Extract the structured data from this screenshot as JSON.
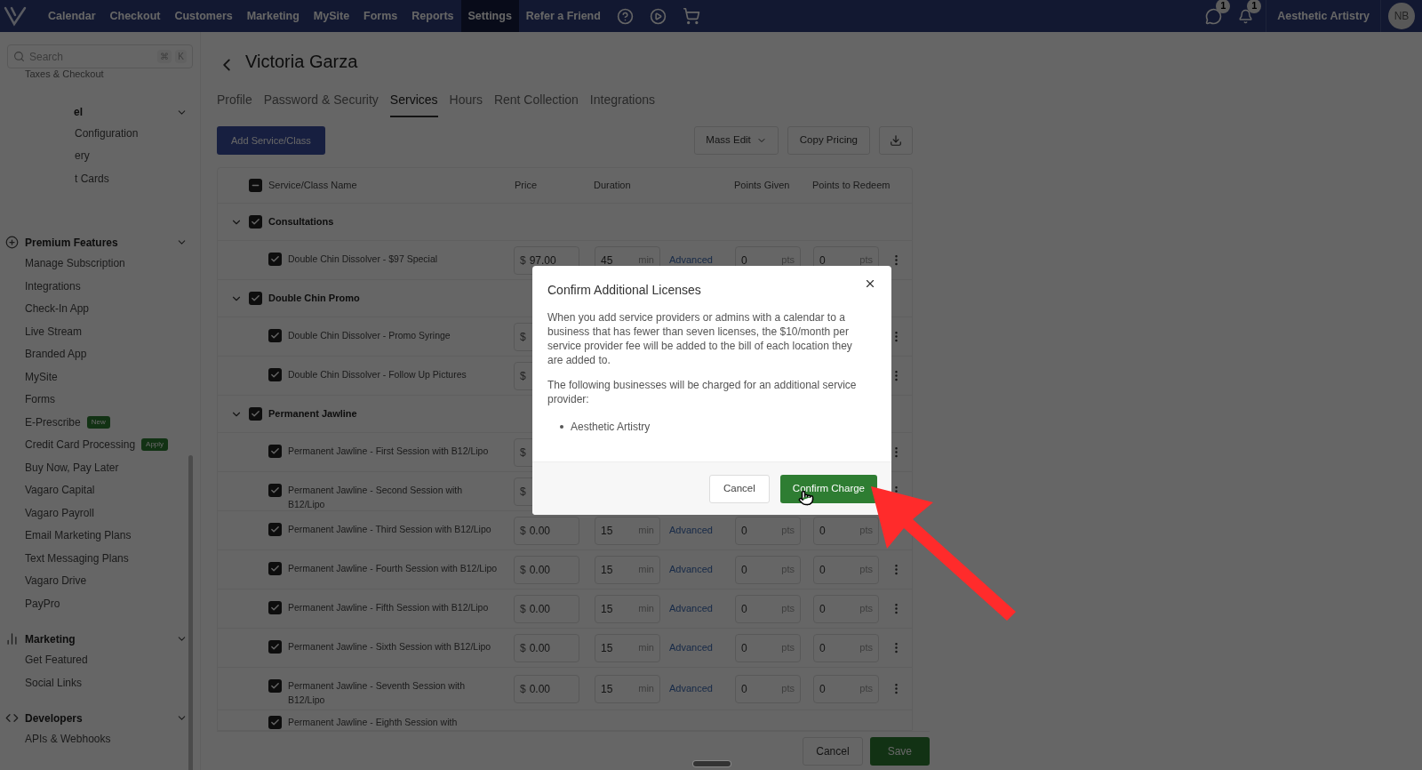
{
  "top_nav": {
    "items": [
      {
        "label": "Calendar",
        "selected": false
      },
      {
        "label": "Checkout",
        "selected": false
      },
      {
        "label": "Customers",
        "selected": false
      },
      {
        "label": "Marketing",
        "selected": false
      },
      {
        "label": "MySite",
        "selected": false
      },
      {
        "label": "Forms",
        "selected": false
      },
      {
        "label": "Reports",
        "selected": false
      },
      {
        "label": "Settings",
        "selected": true
      },
      {
        "label": "Refer a Friend",
        "selected": false
      }
    ],
    "message_badge": "1",
    "notification_badge": "1",
    "business": "Aesthetic Artistry",
    "avatar": "NB"
  },
  "sidebar": {
    "search": {
      "placeholder": "Search",
      "keys": [
        "⌘",
        "K"
      ]
    },
    "leading_items": [
      "Taxes & Checkout"
    ],
    "sections": [
      {
        "title": "el",
        "kind": "plain",
        "expanded": true,
        "items": [
          {
            "label": "Configuration"
          },
          {
            "label": "ery"
          },
          {
            "label": "t Cards"
          }
        ]
      },
      {
        "title": "Premium Features",
        "kind": "premium",
        "expanded": true,
        "items": [
          {
            "label": "Manage Subscription"
          },
          {
            "label": "Integrations"
          },
          {
            "label": "Check-In App"
          },
          {
            "label": "Live Stream"
          },
          {
            "label": "Branded App"
          },
          {
            "label": "MySite"
          },
          {
            "label": "Forms"
          },
          {
            "label": "E-Prescribe",
            "badge": "New"
          },
          {
            "label": "Credit Card Processing",
            "badge": "Apply"
          },
          {
            "label": "Buy Now, Pay Later"
          },
          {
            "label": "Vagaro Capital"
          },
          {
            "label": "Vagaro Payroll"
          },
          {
            "label": "Email Marketing Plans"
          },
          {
            "label": "Text Messaging Plans"
          },
          {
            "label": "Vagaro Drive"
          },
          {
            "label": "PayPro"
          }
        ]
      },
      {
        "title": "Marketing",
        "kind": "marketing",
        "expanded": true,
        "items": [
          {
            "label": "Get Featured"
          },
          {
            "label": "Social Links"
          }
        ]
      },
      {
        "title": "Developers",
        "kind": "developer",
        "expanded": true,
        "items": [
          {
            "label": "APIs & Webhooks"
          }
        ]
      }
    ]
  },
  "page": {
    "title": "Victoria Garza",
    "tabs": [
      {
        "label": "Profile",
        "selected": false
      },
      {
        "label": "Password & Security",
        "selected": false
      },
      {
        "label": "Services",
        "selected": true
      },
      {
        "label": "Hours",
        "selected": false
      },
      {
        "label": "Rent Collection",
        "selected": false
      },
      {
        "label": "Integrations",
        "selected": false
      }
    ],
    "add_button": "Add Service/Class",
    "mass_edit": "Mass Edit",
    "copy_pricing": "Copy Pricing",
    "table": {
      "all_indeterminate": true,
      "columns": [
        "Service/Class Name",
        "Price",
        "Duration",
        "Points Given",
        "Points to Redeem"
      ],
      "groups": [
        {
          "name": "Consultations",
          "checked": true,
          "expanded": true,
          "rows": [
            {
              "name": "Double Chin Dissolver - $97 Special",
              "checked": true,
              "currency": "$",
              "price": "97.00",
              "duration": "45",
              "duration_unit": "min",
              "advanced": "Advanced",
              "points_given": "0",
              "points_given_unit": "pts",
              "points_redeem": "0",
              "points_redeem_unit": "pts"
            }
          ]
        },
        {
          "name": "Double Chin Promo",
          "checked": true,
          "expanded": true,
          "rows": [
            {
              "name": "Double Chin Dissolver - Promo Syringe",
              "checked": true,
              "currency": "$"
            },
            {
              "name": "Double Chin Dissolver - Follow Up Pictures",
              "checked": true,
              "currency": "$"
            }
          ]
        },
        {
          "name": "Permanent Jawline",
          "checked": true,
          "expanded": true,
          "rows": [
            {
              "name": "Permanent Jawline - First Session with B12/Lipo",
              "checked": true,
              "currency": "$"
            },
            {
              "name": "Permanent Jawline - Second Session with B12/Lipo",
              "checked": true,
              "currency": "$"
            },
            {
              "name": "Permanent Jawline - Third Session with B12/Lipo",
              "checked": true,
              "currency": "$",
              "price": "0.00",
              "duration": "15",
              "duration_unit": "min",
              "advanced": "Advanced",
              "points_given": "0",
              "points_given_unit": "pts",
              "points_redeem": "0",
              "points_redeem_unit": "pts"
            },
            {
              "name": "Permanent Jawline - Fourth Session with B12/Lipo",
              "checked": true,
              "currency": "$",
              "price": "0.00",
              "duration": "15",
              "duration_unit": "min",
              "advanced": "Advanced",
              "points_given": "0",
              "points_given_unit": "pts",
              "points_redeem": "0",
              "points_redeem_unit": "pts"
            },
            {
              "name": "Permanent Jawline - Fifth Session with B12/Lipo",
              "checked": true,
              "currency": "$",
              "price": "0.00",
              "duration": "15",
              "duration_unit": "min",
              "advanced": "Advanced",
              "points_given": "0",
              "points_given_unit": "pts",
              "points_redeem": "0",
              "points_redeem_unit": "pts"
            },
            {
              "name": "Permanent Jawline - Sixth Session with B12/Lipo",
              "checked": true,
              "currency": "$",
              "price": "0.00",
              "duration": "15",
              "duration_unit": "min",
              "advanced": "Advanced",
              "points_given": "0",
              "points_given_unit": "pts",
              "points_redeem": "0",
              "points_redeem_unit": "pts"
            },
            {
              "name": "Permanent Jawline - Seventh Session with B12/Lipo",
              "checked": true,
              "currency": "$",
              "price": "0.00",
              "duration": "15",
              "duration_unit": "min",
              "advanced": "Advanced",
              "points_given": "0",
              "points_given_unit": "pts",
              "points_redeem": "0",
              "points_redeem_unit": "pts"
            },
            {
              "name": "Permanent Jawline - Eighth Session with",
              "checked": true
            }
          ]
        }
      ]
    },
    "footer": {
      "cancel": "Cancel",
      "save": "Save"
    }
  },
  "modal": {
    "title": "Confirm Additional Licenses",
    "paragraphs": [
      "When you add service providers or admins with a calendar to a business that has fewer than seven licenses, the $10/month per service provider fee will be added to the bill of each location they are added to.",
      "The following businesses will be charged for an additional service provider:"
    ],
    "businesses": [
      "Aesthetic Artistry"
    ],
    "cancel": "Cancel",
    "confirm": "Confirm Charge"
  }
}
